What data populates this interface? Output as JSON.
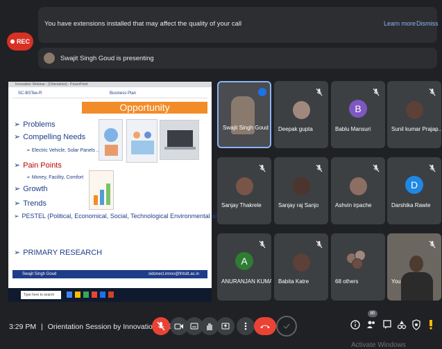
{
  "recording": {
    "label": "REC"
  },
  "banner": {
    "message": "You have extensions installed that may affect the quality of your call",
    "learn_more": "Learn more",
    "dismiss": "Dismiss"
  },
  "presenting": {
    "text": "Swajit Singh Goud is presenting"
  },
  "shared_slide": {
    "window_title": "Innovation Webinar - [Orientation] - PowerPoint",
    "course_code": "SC-BSTee-R",
    "header": "Business Plan",
    "title": "Opportunity",
    "bullets": [
      {
        "text": "Problems"
      },
      {
        "text": "Compelling Needs"
      },
      {
        "text": "Electric Vehicle, Solar Panels ..",
        "sub": true
      },
      {
        "text": "Pain Points",
        "accent": true
      },
      {
        "text": "Money, Facility, Comfort",
        "sub": true
      },
      {
        "text": "Growth"
      },
      {
        "text": "Trends"
      },
      {
        "text": "PESTEL (Political, Economical, Social, Technological Environmental and Legal)"
      },
      {
        "text": "PRIMARY RESEARCH"
      }
    ],
    "footer_left": "Swajit Singh Goud",
    "footer_right": "sidonect.innov@fritsitt.ac.in",
    "taskbar_search": "Type here to search"
  },
  "participants": [
    {
      "name": "Swajit Singh Goud",
      "type": "video",
      "speaking": true
    },
    {
      "name": "Deepak gupta",
      "type": "photo",
      "muted": true
    },
    {
      "name": "Bablu Mansuri",
      "type": "letter",
      "letter": "B",
      "color": "#7e57c2",
      "muted": true
    },
    {
      "name": "Sunil kumar Prajap...",
      "type": "photo",
      "muted": true
    },
    {
      "name": "Sanjay Thakrele",
      "type": "photo",
      "muted": true
    },
    {
      "name": "Sanjay raj Sanjo",
      "type": "photo",
      "muted": true
    },
    {
      "name": "Ashvin irpache",
      "type": "photo",
      "muted": true
    },
    {
      "name": "Darshika Rawte",
      "type": "letter",
      "letter": "D",
      "color": "#1e88e5",
      "muted": true
    },
    {
      "name": "ANURANJAN KUMAR",
      "type": "letter",
      "letter": "A",
      "color": "#2e7d32",
      "muted": true
    },
    {
      "name": "Babita Katre",
      "type": "photo",
      "muted": true
    },
    {
      "name": "68 others",
      "type": "group"
    },
    {
      "name": "You",
      "type": "video",
      "muted": true
    }
  ],
  "bottom_bar": {
    "time": "3:29 PM",
    "separator": "|",
    "meeting_title": "Orientation Session by Innovation Ambassa...",
    "participant_count": "80"
  },
  "os_watermark": "Activate Windows",
  "colors": {
    "accent_red": "#ea4335",
    "link_blue": "#8ab4f8",
    "slide_orange": "#f28c28",
    "slide_navy": "#1f3c88"
  }
}
